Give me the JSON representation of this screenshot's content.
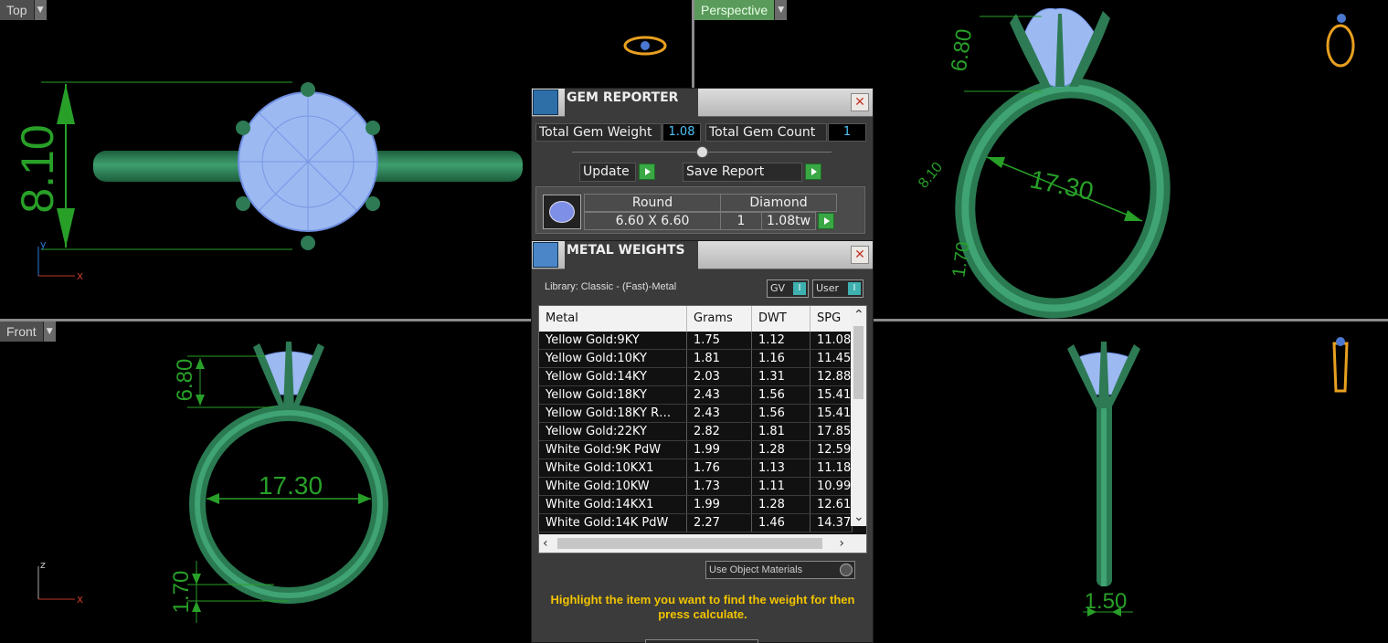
{
  "viewports": {
    "top": {
      "label": "Top",
      "dim_height": "8.10",
      "axis_v": "y",
      "axis_h": "x"
    },
    "perspective": {
      "label": "Perspective",
      "dim_top": "6.80",
      "dim_ring": "17.30",
      "dim_small": "8.10",
      "dim_band": "1.70"
    },
    "front": {
      "label": "Front",
      "dim_top": "6.80",
      "dim_ring": "17.30",
      "dim_band": "1.70",
      "axis_v": "z",
      "axis_h": "x"
    },
    "right": {
      "dim_width": "1.50"
    }
  },
  "gem_reporter": {
    "title": "GEM REPORTER",
    "total_weight_label": "Total Gem Weight",
    "total_weight_value": "1.08",
    "total_count_label": "Total Gem Count",
    "total_count_value": "1",
    "update_label": "Update",
    "save_label": "Save Report",
    "gem": {
      "shape": "Round",
      "material": "Diamond",
      "size": "6.60 X 6.60",
      "count": "1",
      "weight": "1.08tw"
    }
  },
  "metal_weights": {
    "title": "METAL WEIGHTS",
    "library": "Library: Classic - (Fast)-Metal",
    "gv_label": "GV",
    "user_label": "User",
    "columns": [
      "Metal",
      "Grams",
      "DWT",
      "SPG"
    ],
    "rows": [
      {
        "metal": "Yellow Gold:9KY",
        "grams": "1.75",
        "dwt": "1.12",
        "spg": "11.08"
      },
      {
        "metal": "Yellow Gold:10KY",
        "grams": "1.81",
        "dwt": "1.16",
        "spg": "11.45"
      },
      {
        "metal": "Yellow Gold:14KY",
        "grams": "2.03",
        "dwt": "1.31",
        "spg": "12.88"
      },
      {
        "metal": "Yellow Gold:18KY",
        "grams": "2.43",
        "dwt": "1.56",
        "spg": "15.41"
      },
      {
        "metal": "Yellow Gold:18KY R…",
        "grams": "2.43",
        "dwt": "1.56",
        "spg": "15.41"
      },
      {
        "metal": "Yellow Gold:22KY",
        "grams": "2.82",
        "dwt": "1.81",
        "spg": "17.85"
      },
      {
        "metal": "White Gold:9K PdW",
        "grams": "1.99",
        "dwt": "1.28",
        "spg": "12.59"
      },
      {
        "metal": "White Gold:10KX1",
        "grams": "1.76",
        "dwt": "1.13",
        "spg": "11.18"
      },
      {
        "metal": "White Gold:10KW",
        "grams": "1.73",
        "dwt": "1.11",
        "spg": "10.99"
      },
      {
        "metal": "White Gold:14KX1",
        "grams": "1.99",
        "dwt": "1.28",
        "spg": "12.61"
      },
      {
        "metal": "White Gold:14K PdW",
        "grams": "2.27",
        "dwt": "1.46",
        "spg": "14.37"
      }
    ],
    "use_object_materials": "Use Object Materials",
    "hint": "Highlight the item you want to find the weight for then press calculate."
  },
  "colors": {
    "ring_green": "#2f8a5a",
    "gem_blue": "#9bb8f0",
    "dimension_green": "#28a028",
    "hint_yellow": "#f2c400"
  }
}
